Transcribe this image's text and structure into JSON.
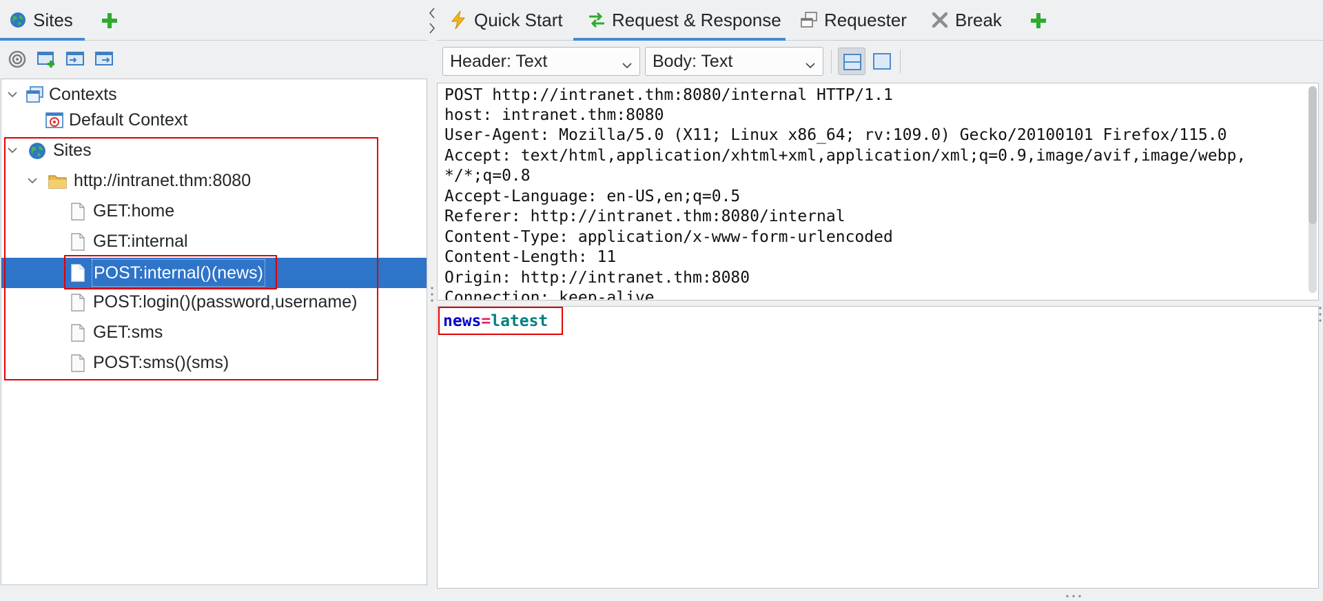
{
  "left": {
    "tabs": [
      {
        "label": "Sites",
        "icon": "globe-icon",
        "active": true
      }
    ],
    "add_tab_icon": "plus-icon",
    "toolbar_icons": [
      "target-icon",
      "new-context-icon",
      "import-context-icon",
      "export-context-icon"
    ],
    "tree": {
      "contexts_label": "Contexts",
      "default_context_label": "Default Context",
      "sites_label": "Sites",
      "host_label": "http://intranet.thm:8080",
      "nodes": [
        {
          "label": "GET:home",
          "selected": false
        },
        {
          "label": "GET:internal",
          "selected": false
        },
        {
          "label": "POST:internal()(news)",
          "selected": true
        },
        {
          "label": "POST:login()(password,username)",
          "selected": false
        },
        {
          "label": "GET:sms",
          "selected": false
        },
        {
          "label": "POST:sms()(sms)",
          "selected": false
        }
      ]
    }
  },
  "right": {
    "tabs": [
      {
        "label": "Quick Start",
        "icon": "lightning-icon"
      },
      {
        "label": "Request & Response",
        "icon": "swap-arrows-icon",
        "active": true
      },
      {
        "label": "Requester",
        "icon": "windows-icon"
      },
      {
        "label": "Break",
        "icon": "cross-icon"
      }
    ],
    "add_tab_icon": "plus-icon",
    "header_view_select": "Header: Text",
    "body_view_select": "Body: Text",
    "header_lines": [
      "POST http://intranet.thm:8080/internal HTTP/1.1",
      "host: intranet.thm:8080",
      "User-Agent: Mozilla/5.0 (X11; Linux x86_64; rv:109.0) Gecko/20100101 Firefox/115.0",
      "Accept: text/html,application/xhtml+xml,application/xml;q=0.9,image/avif,image/webp,",
      "*/*;q=0.8",
      "Accept-Language: en-US,en;q=0.5",
      "Referer: http://intranet.thm:8080/internal",
      "Content-Type: application/x-www-form-urlencoded",
      "Content-Length: 11",
      "Origin: http://intranet.thm:8080",
      "Connection: keep-alive"
    ],
    "body": {
      "param_name": "news",
      "equals": "=",
      "param_value": "latest"
    },
    "colors": {
      "param_name": "#0000cc",
      "equals": "#e0206a",
      "param_value": "#008080",
      "selection": "#2e74c9",
      "annotation": "#e00000"
    }
  }
}
